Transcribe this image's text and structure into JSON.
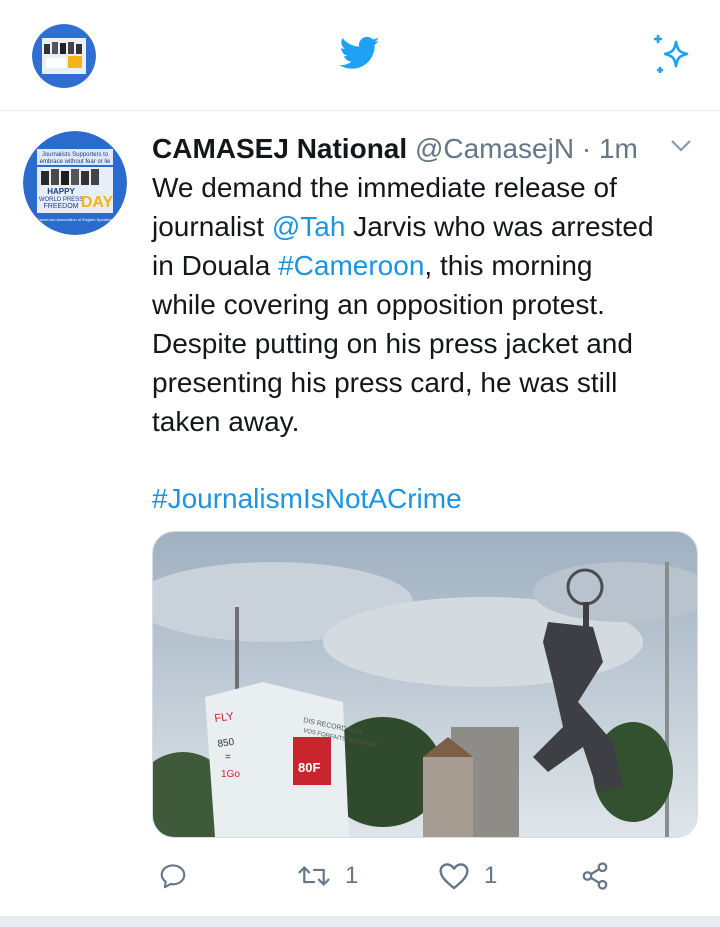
{
  "colors": {
    "accent": "#1da1f2",
    "link": "#1b95e0",
    "muted": "#657786",
    "text": "#14171a"
  },
  "topbar": {
    "profile_avatar_icon": "account-avatar",
    "logo_icon": "twitter-bird-icon",
    "sparkle_icon": "sparkle-icon"
  },
  "tweet": {
    "author_name": "CAMASEJ National",
    "author_handle": "@CamasejN",
    "separator": "·",
    "time": "1m",
    "body_lines": [
      {
        "pre": "We demand the immediate release of",
        "link": "",
        "post": ""
      },
      {
        "pre": "journalist ",
        "link": "@Tah",
        "post": " Jarvis who was arrested"
      },
      {
        "pre": "in Douala ",
        "link": "#Cameroon",
        "post": ", this morning"
      },
      {
        "pre": "while covering an opposition protest.",
        "link": "",
        "post": ""
      },
      {
        "pre": "Despite putting on his press jacket and",
        "link": "",
        "post": ""
      },
      {
        "pre": "presenting his press card, he was still",
        "link": "",
        "post": ""
      },
      {
        "pre": "taken away.",
        "link": "",
        "post": ""
      }
    ],
    "hashtag": "#JournalismIsNotACrime",
    "media": {
      "billboard": [
        "DIS RECORD SUR",
        "VOS FORFAITS INTERNET",
        "FLY",
        "850",
        "=",
        "1Go",
        "80F"
      ]
    },
    "actions": {
      "reply_count": "",
      "retweet_count": "1",
      "like_count": "1"
    }
  },
  "avatar_text": {
    "top": "Journalists Supporters to",
    "top2": "embrace without fear or lie",
    "happy": "HAPPY",
    "world": "WORLD PRESS",
    "freedom": "FREEDOM",
    "day": "DAY",
    "bottom": "Cameroon Association of English Speaking"
  }
}
